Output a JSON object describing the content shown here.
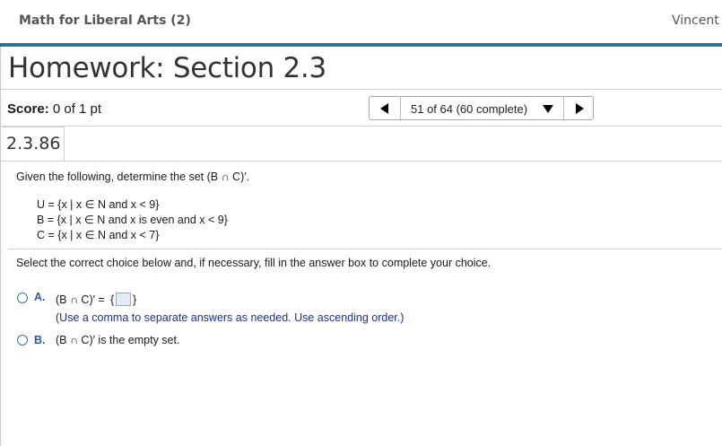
{
  "header": {
    "course_title": "Math for Liberal Arts (2)",
    "user_name": "Vincent T"
  },
  "homework": {
    "title": "Homework: Section 2.3"
  },
  "score": {
    "label": "Score:",
    "value": "0 of 1 pt"
  },
  "navigation": {
    "counter": "51 of 64 (60 complete)",
    "prev_icon": "triangle-left-icon",
    "next_icon": "triangle-right-icon",
    "dropdown_icon": "caret-down-icon"
  },
  "question": {
    "id": "2.3.86",
    "prompt": "Given the following, determine the set (B ∩ C)′.",
    "sets": [
      "U = {x | x ∈ N and x < 9}",
      "B = {x | x ∈ N and x is even and x < 9}",
      "C = {x | x ∈ N and x < 7}"
    ],
    "instruction": "Select the correct choice below and, if necessary, fill in the answer box to complete your choice.",
    "choices": {
      "a": {
        "letter": "A.",
        "text_before": "(B ∩ C)′ =",
        "brace_open": "{",
        "brace_close": "}",
        "answer_value": "",
        "hint": "(Use a comma to separate answers as needed. Use ascending order.)"
      },
      "b": {
        "letter": "B.",
        "text": "(B ∩ C)′ is the empty set."
      }
    }
  },
  "colors": {
    "accent": "#2f6f8f",
    "choice_letter": "#2c5aa0",
    "hint_text": "#1a2f9c"
  }
}
